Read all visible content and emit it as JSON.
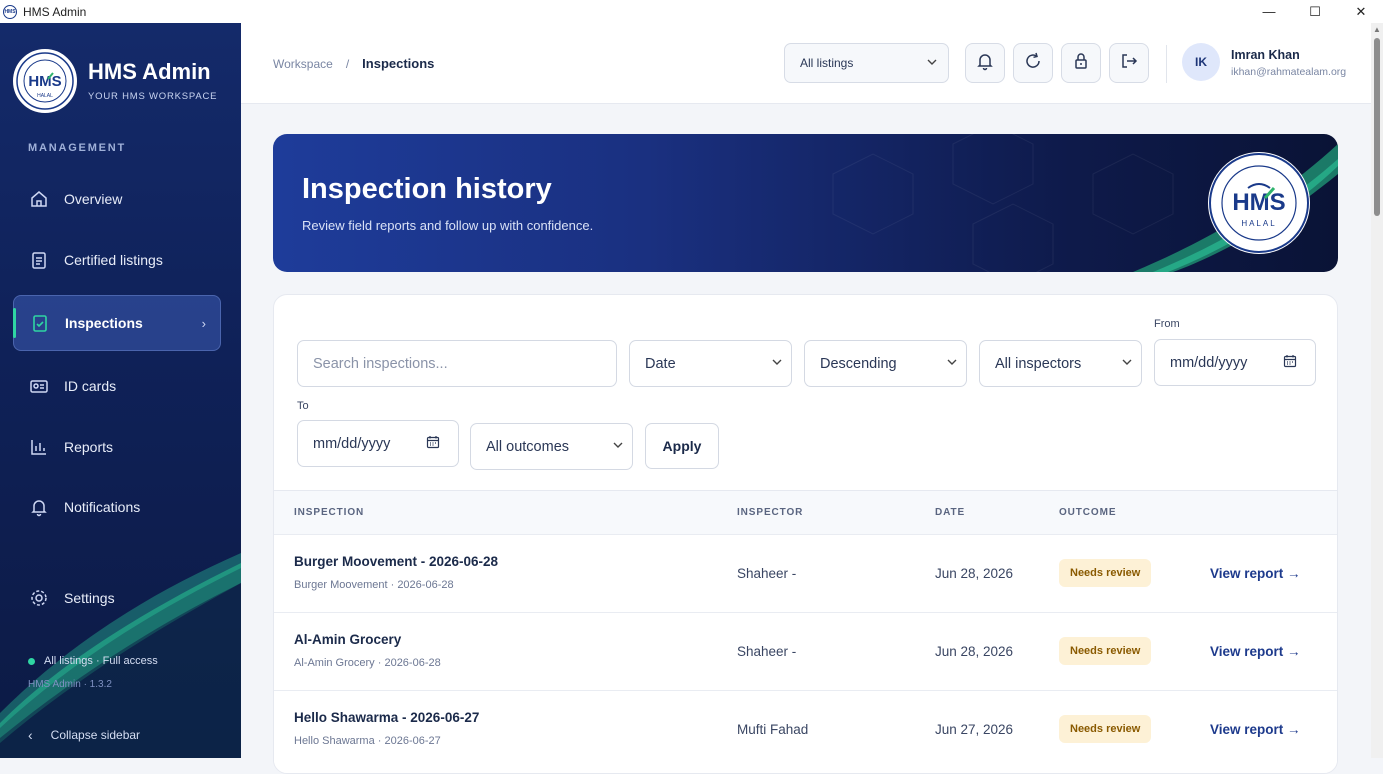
{
  "window": {
    "title": "HMS Admin"
  },
  "sidebar": {
    "brand": "HMS Admin",
    "brand_sub": "YOUR HMS WORKSPACE",
    "section": "MANAGEMENT",
    "items": [
      {
        "label": "Overview",
        "icon": "home-icon"
      },
      {
        "label": "Certified listings",
        "icon": "clipboard-icon"
      },
      {
        "label": "Inspections",
        "icon": "clipboard-check-icon",
        "active": true
      },
      {
        "label": "ID cards",
        "icon": "id-card-icon"
      },
      {
        "label": "Reports",
        "icon": "bar-chart-icon"
      },
      {
        "label": "Notifications",
        "icon": "bell-icon"
      }
    ],
    "settings": "Settings",
    "status": "All listings · Full access",
    "version": "HMS Admin · 1.3.2",
    "collapse": "Collapse sidebar"
  },
  "header": {
    "breadcrumb_root": "Workspace",
    "breadcrumb_sep": "/",
    "breadcrumb_current": "Inspections",
    "listing_select": "All listings",
    "user": {
      "initials": "IK",
      "name": "Imran Khan",
      "email": "ikhan@rahmatealam.org"
    }
  },
  "hero": {
    "title": "Inspection history",
    "subtitle": "Review field reports and follow up with confidence."
  },
  "filters": {
    "search_placeholder": "Search inspections...",
    "sort_field": "Date",
    "sort_order": "Descending",
    "inspector": "All inspectors",
    "from_label": "From",
    "from_placeholder": "mm/dd/yyyy",
    "to_label": "To",
    "to_placeholder": "mm/dd/yyyy",
    "outcome": "All outcomes",
    "apply": "Apply"
  },
  "table": {
    "columns": [
      "INSPECTION",
      "INSPECTOR",
      "DATE",
      "OUTCOME"
    ],
    "rows": [
      {
        "title": "Burger Moovement - 2026-06-28",
        "sub": "Burger Moovement · 2026-06-28",
        "inspector": "Shaheer -",
        "date": "Jun 28, 2026",
        "outcome": "Needs review",
        "action": "View report →"
      },
      {
        "title": "Al-Amin Grocery",
        "sub": "Al-Amin Grocery · 2026-06-28",
        "inspector": "Shaheer -",
        "date": "Jun 28, 2026",
        "outcome": "Needs review",
        "action": "View report →"
      },
      {
        "title": "Hello Shawarma - 2026-06-27",
        "sub": "Hello Shawarma · 2026-06-27",
        "inspector": "Mufti Fahad",
        "date": "Jun 27, 2026",
        "outcome": "Needs review",
        "action": "View report →"
      }
    ]
  },
  "colors": {
    "sidebar": "#0f2158",
    "accent": "#2fd6a3",
    "link": "#1d3a8c",
    "badge_bg": "#fdf1d6",
    "badge_text": "#8a5a00"
  }
}
